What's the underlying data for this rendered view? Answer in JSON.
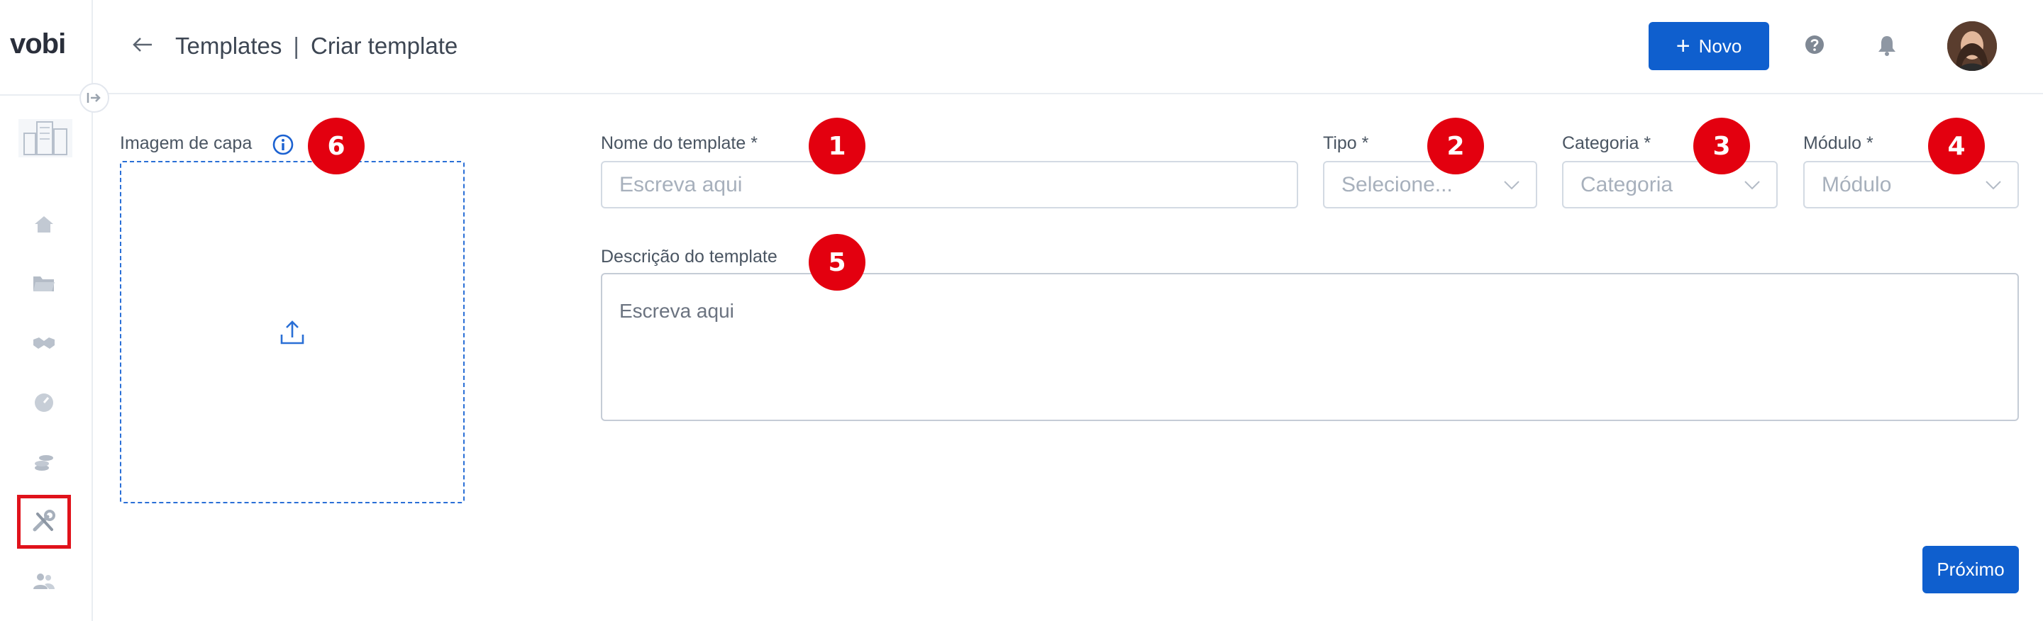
{
  "app": {
    "logo": "vobi"
  },
  "colors": {
    "primary": "#0f5fce",
    "badge": "#e3000f",
    "highlight": "#e0121b"
  },
  "sidebar": {
    "collapse_icon": "arrow-right-icon",
    "items": [
      {
        "name": "home",
        "icon": "home-icon"
      },
      {
        "name": "projects",
        "icon": "folder-icon"
      },
      {
        "name": "suppliers",
        "icon": "handshake-icon"
      },
      {
        "name": "reports",
        "icon": "gauge-icon"
      },
      {
        "name": "finance",
        "icon": "coins-icon"
      },
      {
        "name": "tools",
        "icon": "tools-icon",
        "active": true
      },
      {
        "name": "users",
        "icon": "users-icon"
      }
    ]
  },
  "header": {
    "breadcrumb": {
      "parent": "Templates",
      "separator": "|",
      "current": "Criar template"
    },
    "new_button": "Novo"
  },
  "form": {
    "cover_image": {
      "label": "Imagem de capa"
    },
    "template_name": {
      "label": "Nome do template *",
      "placeholder": "Escreva aqui"
    },
    "type": {
      "label": "Tipo *",
      "placeholder": "Selecione..."
    },
    "category": {
      "label": "Categoria *",
      "placeholder": "Categoria"
    },
    "module": {
      "label": "Módulo *",
      "placeholder": "Módulo"
    },
    "description": {
      "label": "Descrição do template",
      "placeholder": "Escreva aqui"
    },
    "next_button": "Próximo"
  },
  "annotations": [
    "1",
    "2",
    "3",
    "4",
    "5",
    "6"
  ]
}
